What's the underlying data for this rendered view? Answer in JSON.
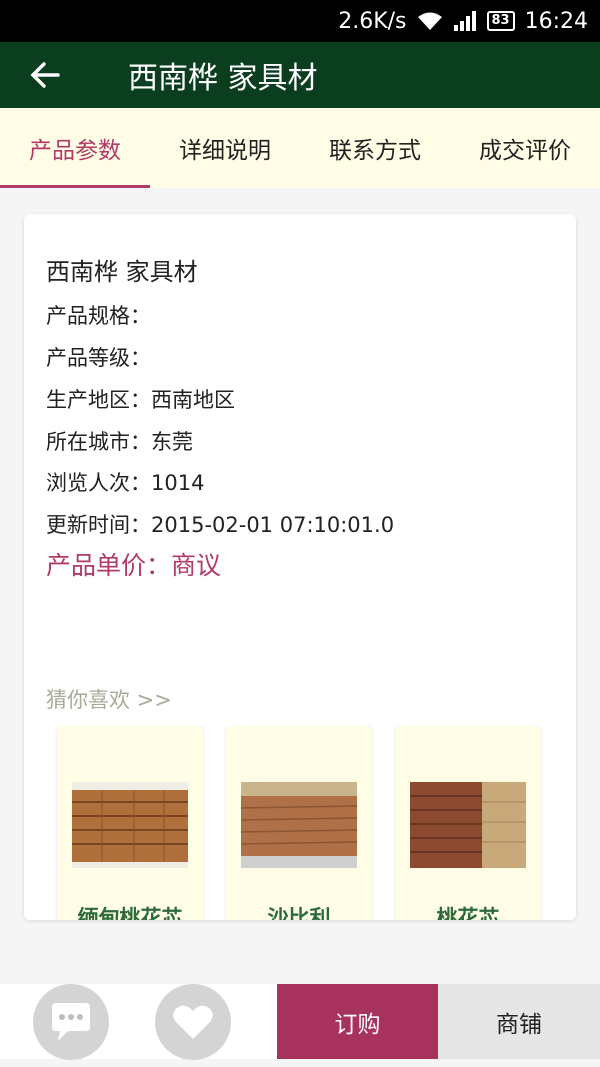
{
  "status_bar": {
    "speed": "2.6K/s",
    "battery": "83",
    "time": "16:24"
  },
  "header": {
    "back_icon": "arrow-left-icon",
    "title": "西南桦 家具材"
  },
  "tabs": [
    {
      "label": "产品参数",
      "active": true
    },
    {
      "label": "详细说明",
      "active": false
    },
    {
      "label": "联系方式",
      "active": false
    },
    {
      "label": "成交评价",
      "active": false
    }
  ],
  "product": {
    "name": "西南桦 家具材",
    "spec": "产品规格：",
    "grade": "产品等级：",
    "origin": "生产地区：西南地区",
    "city": "所在城市：东莞",
    "views": "浏览人次：1014",
    "updated": "更新时间：2015-02-01 07:10:01.0",
    "price": "产品单价：商议"
  },
  "recommend": {
    "heading": "猜你喜欢 >>",
    "items": [
      {
        "label": "缅甸桃花芯"
      },
      {
        "label": "沙比利"
      },
      {
        "label": "桃花芯"
      }
    ]
  },
  "bottom_bar": {
    "chat_icon": "chat-bubble-icon",
    "favorite_icon": "heart-icon",
    "order_label": "订购",
    "shop_label": "商铺"
  },
  "colors": {
    "header_bg": "#0b3d1f",
    "accent": "#b03a68",
    "tab_bg": "#fffde6"
  }
}
